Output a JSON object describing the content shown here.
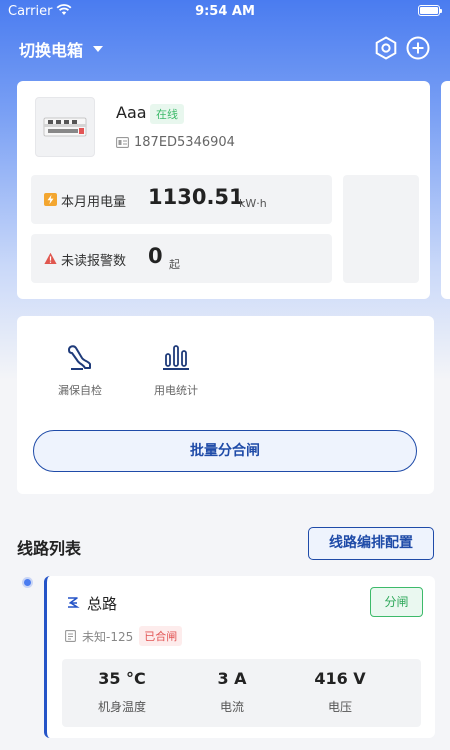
{
  "status_bar": {
    "carrier": "Carrier",
    "time": "9:54 AM"
  },
  "nav": {
    "title": "切换电箱",
    "icons": [
      "settings-hex-icon",
      "add-circle-icon"
    ]
  },
  "device": {
    "name": "Aaa",
    "status": "在线",
    "id": "187ED5346904",
    "energy_label": "本月用电量",
    "energy_value": "1130.51",
    "energy_unit": "kW·h",
    "alarm_label": "未读报警数",
    "alarm_value": "0",
    "alarm_unit": "起"
  },
  "tools": {
    "items": [
      {
        "label": "漏保自检",
        "icon": "leak-test-icon"
      },
      {
        "label": "用电统计",
        "icon": "power-stats-icon"
      }
    ],
    "batch_button": "批量分合闸"
  },
  "circuits": {
    "title": "线路列表",
    "config_button": "线路编排配置",
    "items": [
      {
        "name": "总路",
        "state": "分闸",
        "model": "未知-125",
        "closed_tag": "已合闸",
        "temp_value": "35 °C",
        "temp_label": "机身温度",
        "current_value": "3 A",
        "current_label": "电流",
        "voltage_value": "416 V",
        "voltage_label": "电压"
      }
    ]
  },
  "colors": {
    "accent": "#1f4ba8",
    "online": "#3dba6a",
    "alert": "#e25555"
  }
}
